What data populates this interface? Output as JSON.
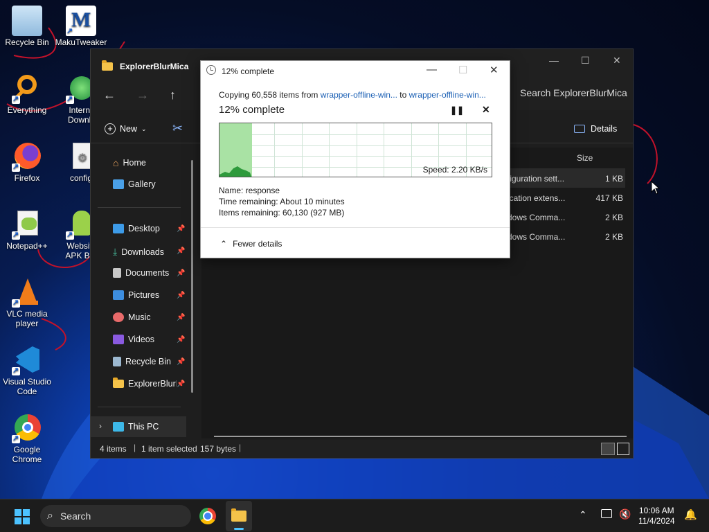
{
  "desktop_icons": [
    {
      "label": "Recycle Bin"
    },
    {
      "label": "MakuTweaker"
    },
    {
      "label": "Everything"
    },
    {
      "label": "Interne Downlo"
    },
    {
      "label": "Firefox"
    },
    {
      "label": "config"
    },
    {
      "label": "Notepad++"
    },
    {
      "label": "Website APK Buil"
    },
    {
      "label": "VLC media player"
    },
    {
      "label": "Visual Studio Code"
    },
    {
      "label": "Google Chrome"
    }
  ],
  "explorer": {
    "title": "ExplorerBlurMica",
    "search_placeholder": "Search ExplorerBlurMica",
    "toolbar": {
      "new_label": "New",
      "details_label": "Details"
    },
    "column_size": "Size",
    "sidebar": [
      {
        "label": "Home"
      },
      {
        "label": "Gallery"
      },
      {
        "label": "Desktop"
      },
      {
        "label": "Downloads"
      },
      {
        "label": "Documents"
      },
      {
        "label": "Pictures"
      },
      {
        "label": "Music"
      },
      {
        "label": "Videos"
      },
      {
        "label": "Recycle Bin"
      },
      {
        "label": "ExplorerBlurM"
      },
      {
        "label": "This PC"
      }
    ],
    "files": [
      {
        "type": "figuration sett...",
        "size": "1 KB"
      },
      {
        "type": "ication extens...",
        "size": "417 KB"
      },
      {
        "type": "dows Comma...",
        "size": "2 KB"
      },
      {
        "type": "dows Comma...",
        "size": "2 KB"
      }
    ],
    "status": {
      "items": "4 items",
      "selected": "1 item selected",
      "bytes": "157 bytes"
    }
  },
  "dialog": {
    "title": "12% complete",
    "copy_prefix": "Copying 60,558 items from",
    "source": "wrapper-offline-win...",
    "to": "to",
    "dest": "wrapper-offline-win...",
    "heading": "12% complete",
    "progress": 0.12,
    "speed": "Speed: 2.20 KB/s",
    "name_label": "Name:",
    "name_value": "response",
    "time_label": "Time remaining:",
    "time_value": "About 10 minutes",
    "items_label": "Items remaining:",
    "items_value": "60,130 (927 MB)",
    "fewer_details": "Fewer details"
  },
  "taskbar": {
    "search_label": "Search",
    "time": "10:06 AM",
    "date": "11/4/2024"
  }
}
